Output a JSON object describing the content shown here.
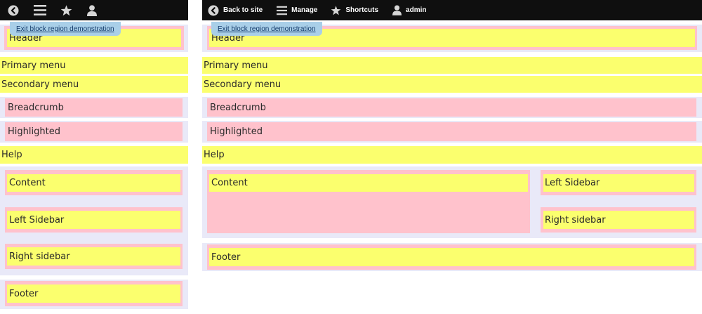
{
  "toolbar": {
    "back_to_site": "Back to site",
    "manage": "Manage",
    "shortcuts": "Shortcuts",
    "user": "admin"
  },
  "exit_link": "Exit block region demonstration",
  "regions": {
    "header": "Header",
    "primary_menu": "Primary menu",
    "secondary_menu": "Secondary menu",
    "breadcrumb": "Breadcrumb",
    "highlighted": "Highlighted",
    "help": "Help",
    "content": "Content",
    "left_sidebar": "Left Sidebar",
    "right_sidebar": "Right sidebar",
    "footer": "Footer"
  },
  "colors": {
    "toolbar": "#0f0f0f",
    "region_outer": "#e9e9f8",
    "region_block": "#ffc2cc",
    "region_menu": "#fbff6e",
    "exit_link_bg": "#a9cfe8"
  },
  "icons": {
    "back": "back-arrow-circle-icon",
    "manage": "hamburger-menu-icon",
    "shortcuts": "star-icon",
    "user": "user-icon"
  }
}
